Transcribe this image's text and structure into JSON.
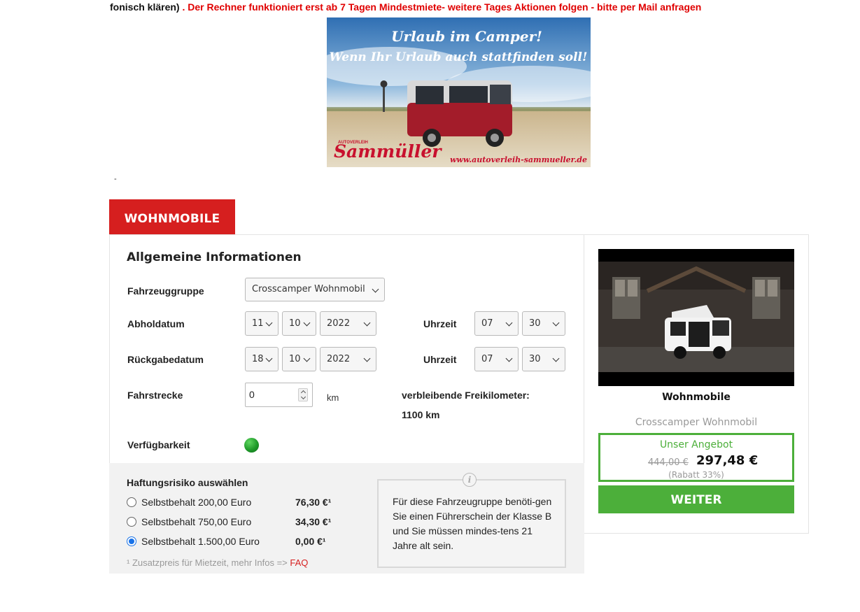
{
  "notice": {
    "black_part": "fonisch klären)",
    "red_part": ". Der Rechner funktioniert  erst ab 7 Tagen Mindestmiete- weitere  Tages Aktionen folgen - bitte per Mail anfragen"
  },
  "banner": {
    "headline_1": "Urlaub im Camper!",
    "headline_2": "Wenn Ihr Urlaub auch stattfinden soll!",
    "brand_small": "AUTOVERLEIH",
    "brand": "Sammüller",
    "url": "www.autoverleih-sammueller.de"
  },
  "separator": "-",
  "tab": {
    "label": "WOHNMOBILE"
  },
  "form": {
    "title": "Allgemeine Informationen",
    "vehicle_group": {
      "label": "Fahrzeuggruppe",
      "value": "Crosscamper Wohnmobil"
    },
    "pickup": {
      "label": "Abholdatum",
      "day": "11",
      "month": "10",
      "year": "2022",
      "time_label": "Uhrzeit",
      "hour": "07",
      "minute": "30"
    },
    "return": {
      "label": "Rückgabedatum",
      "day": "18",
      "month": "10",
      "year": "2022",
      "time_label": "Uhrzeit",
      "hour": "07",
      "minute": "30"
    },
    "distance": {
      "label": "Fahrstrecke",
      "value": "0",
      "unit": "km"
    },
    "free_km": {
      "label": "verbleibende Freikilometer:",
      "value": "1100 km"
    },
    "availability": {
      "label": "Verfügbarkeit",
      "status_color": "#1f9a2a"
    }
  },
  "liability": {
    "title": "Haftungsrisiko auswählen",
    "options": [
      {
        "label": "Selbstbehalt 200,00 Euro",
        "price": "76,30 €¹",
        "checked": false
      },
      {
        "label": "Selbstbehalt 750,00 Euro",
        "price": "34,30 €¹",
        "checked": false
      },
      {
        "label": "Selbstbehalt 1.500,00 Euro",
        "price": "0,00 €¹",
        "checked": true
      }
    ],
    "footnote": "¹ Zusatzpreis für Mietzeit, mehr Infos =>",
    "faq_link": "FAQ"
  },
  "info": {
    "icon": "info-icon",
    "text": "Für diese Fahrzeugruppe benöti-gen Sie einen Führerschein der Klasse B und Sie müssen mindes-tens 21 Jahre alt sein."
  },
  "offer": {
    "vehicle_title": "Wohnmobile",
    "vehicle_subtitle": "Crosscamper Wohnmobil",
    "offer_title": "Unser Angebot",
    "old_price": "444,00 €",
    "new_price": "297,48 €",
    "rebate": "(Rabatt 33%)",
    "button": "WEITER"
  },
  "colors": {
    "brand_red": "#d61f1f",
    "accent_green": "#4caf3a",
    "notice_red": "#e00000"
  }
}
